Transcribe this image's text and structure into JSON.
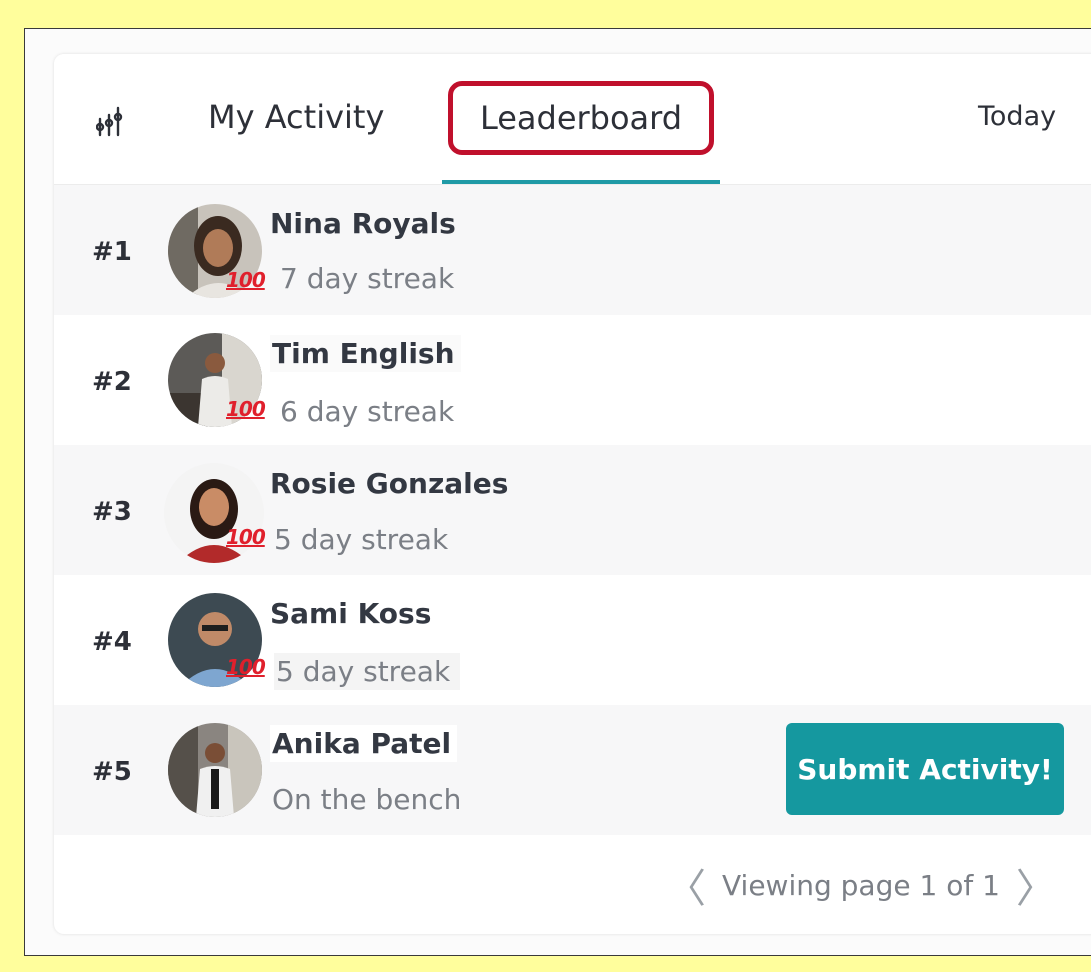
{
  "header": {
    "icon": "bar-chart-icon",
    "tabs": [
      {
        "label": "My Activity",
        "active": false
      },
      {
        "label": "Leaderboard",
        "active": true
      }
    ],
    "period": "Today"
  },
  "leaderboard": [
    {
      "rank": "#1",
      "name": "Nina Royals",
      "streak": "7 day streak",
      "badge": "100"
    },
    {
      "rank": "#2",
      "name": "Tim English",
      "streak": "6 day streak",
      "badge": "100"
    },
    {
      "rank": "#3",
      "name": "Rosie Gonzales",
      "streak": "5 day streak",
      "badge": "100"
    },
    {
      "rank": "#4",
      "name": "Sami Koss",
      "streak": "5 day streak",
      "badge": "100"
    },
    {
      "rank": "#5",
      "name": "Anika Patel",
      "streak": "On the bench",
      "badge": ""
    }
  ],
  "actions": {
    "submit_label": "Submit Activity!"
  },
  "pager": {
    "label": "Viewing page 1 of 1"
  },
  "colors": {
    "accent": "#15989f",
    "highlight": "#c0102c",
    "background": "#fffe9c"
  }
}
